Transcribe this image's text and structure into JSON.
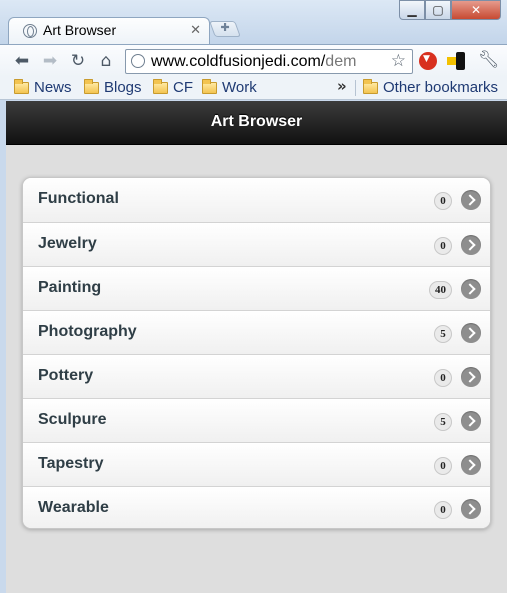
{
  "browser": {
    "tab_title": "Art Browser",
    "url_main": "www.coldfusionjedi.com/",
    "url_rest": "dem",
    "bookmarks": [
      {
        "label": "News"
      },
      {
        "label": "Blogs"
      },
      {
        "label": "CF"
      },
      {
        "label": "Work"
      }
    ],
    "overflow_label": "»",
    "other_bookmarks": "Other bookmarks"
  },
  "page": {
    "title": "Art Browser",
    "categories": [
      {
        "label": "Functional",
        "count": "0"
      },
      {
        "label": "Jewelry",
        "count": "0"
      },
      {
        "label": "Painting",
        "count": "40"
      },
      {
        "label": "Photography",
        "count": "5"
      },
      {
        "label": "Pottery",
        "count": "0"
      },
      {
        "label": "Sculpure",
        "count": "5"
      },
      {
        "label": "Tapestry",
        "count": "0"
      },
      {
        "label": "Wearable",
        "count": "0"
      }
    ]
  },
  "icons": {
    "tab_favicon": "globe-icon",
    "back": "arrow-left-icon",
    "forward": "arrow-right-icon",
    "reload": "reload-icon",
    "home": "home-icon",
    "star": "star-icon",
    "wrench": "wrench-icon",
    "list_arrow": "chevron-right-icon"
  },
  "colors": {
    "header_bg": "#1f1f1f",
    "list_text": "#2f3e46",
    "arrow_bg": "#8e8e8e"
  }
}
